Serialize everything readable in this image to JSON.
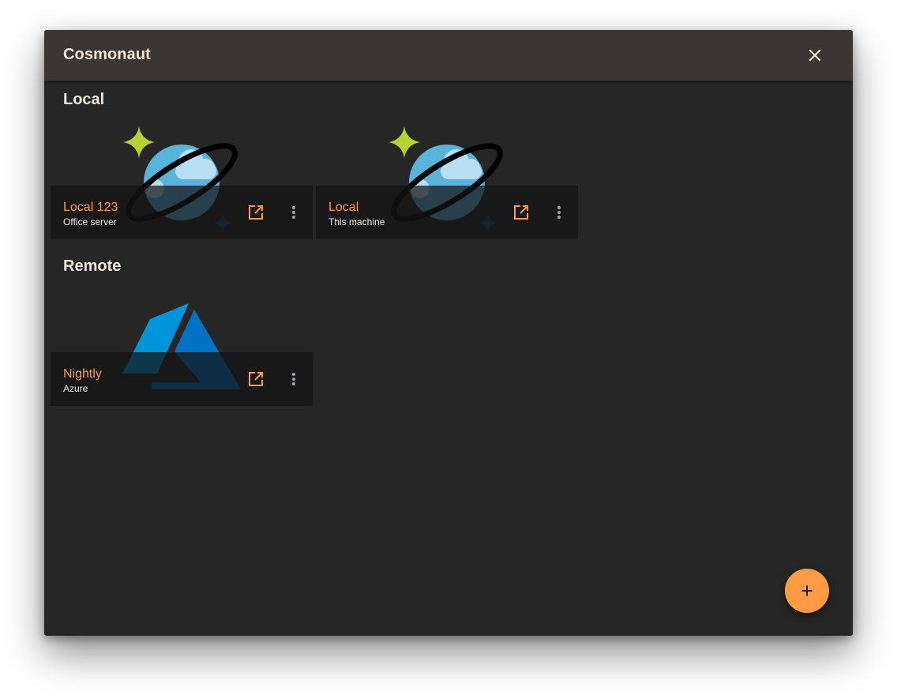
{
  "app": {
    "title": "Cosmonaut"
  },
  "sections": {
    "local": {
      "title": "Local",
      "cards": [
        {
          "name": "Local 123",
          "subtitle": "Office server",
          "icon": "cosmos-db-planet-icon"
        },
        {
          "name": "Local",
          "subtitle": "This machine",
          "icon": "cosmos-db-planet-icon"
        }
      ]
    },
    "remote": {
      "title": "Remote",
      "cards": [
        {
          "name": "Nightly",
          "subtitle": "Azure",
          "icon": "azure-logo-icon"
        }
      ]
    }
  },
  "actions": {
    "close_icon": "close-icon",
    "open_icon": "open-in-new-icon",
    "more_icon": "more-vert-icon",
    "add_icon": "plus-icon"
  },
  "colors": {
    "window_bg": "#262626",
    "titlebar_bg": "#3b3633",
    "accent": "#ff9a45",
    "title_text": "#f1e8da",
    "card_bar": "#1a1a1a"
  }
}
